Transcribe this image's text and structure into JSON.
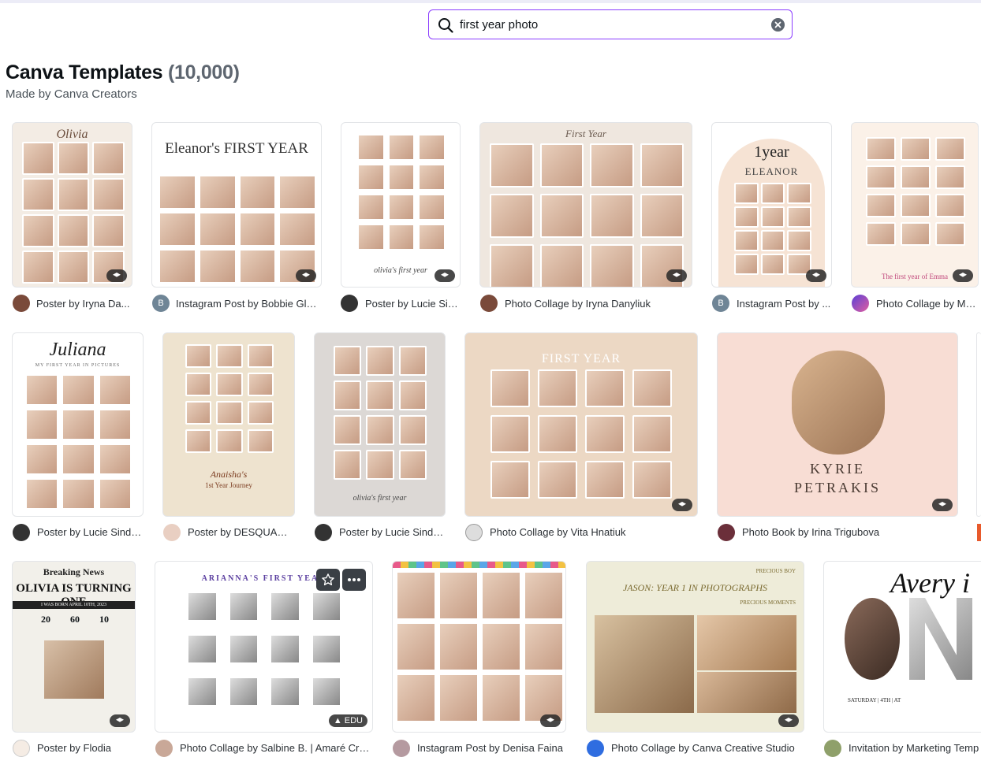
{
  "search": {
    "value": "first year photo",
    "placeholder": "Search"
  },
  "page": {
    "title": "Canva Templates",
    "count": "(10,000)",
    "subtitle": "Made by Canva Creators"
  },
  "templates": [
    {
      "caption": "Poster by Iryna Da...",
      "title": "Olivia"
    },
    {
      "caption": "Instagram Post by Bobbie Gle...",
      "title": "Eleanor's FIRST YEAR",
      "avatar_letter": "B"
    },
    {
      "caption": "Poster by Lucie Sin...",
      "footer": "olivia's first year"
    },
    {
      "caption": "Photo Collage by Iryna Danyliuk",
      "title": "First Year"
    },
    {
      "caption": "Instagram Post by ...",
      "title": "1year",
      "subtitle": "ELEANOR",
      "avatar_letter": "B"
    },
    {
      "caption": "Photo Collage by Me...",
      "footer": "The first year of Emma"
    },
    {
      "caption": "Poster by Lucie Sinde...",
      "title": "Juliana",
      "subtitle": "MY FIRST YEAR IN PICTURES"
    },
    {
      "caption": "Poster by DESQUARED",
      "title": "Anaisha's",
      "subtitle": "1st Year Journey"
    },
    {
      "caption": "Poster by Lucie Sinde...",
      "footer": "olivia's first year"
    },
    {
      "caption": "Photo Collage by Vita Hnatiuk",
      "title": "FIRST YEAR"
    },
    {
      "caption": "Photo Book by Irina Trigubova",
      "title": "KYRIE",
      "subtitle": "PETRAKIS"
    },
    {
      "caption": "Poster by Flodia",
      "title": "OLIVIA IS TURNING ONE",
      "masthead": "Breaking News",
      "line": "I WAS BORN APRIL 10TH, 2023",
      "stats": [
        "20",
        "60",
        "10"
      ]
    },
    {
      "caption": "Photo Collage by Salbine B. | Amaré Crea...",
      "title": "ARIANNA'S FIRST YEAR",
      "badge": "EDU"
    },
    {
      "caption": "Instagram Post by Denisa Faina"
    },
    {
      "caption": "Photo Collage by Canva Creative Studio",
      "title": "JASON: YEAR 1 IN PHOTOGRAPHS",
      "kicker": "PRECIOUS BOY",
      "kicker2": "PRECIOUS MOMENTS"
    },
    {
      "caption": "Invitation by Marketing Temp",
      "title": "Avery i",
      "footer": "SATURDAY | 4TH | AT"
    }
  ],
  "colors": {
    "accent": "#8b3dff",
    "text": "#0d1216",
    "muted": "#5e6670"
  },
  "icons": {
    "search": "search-icon",
    "clear": "clear-icon",
    "premium": "graduation-cap-icon",
    "star": "star-icon",
    "more": "more-icon"
  }
}
